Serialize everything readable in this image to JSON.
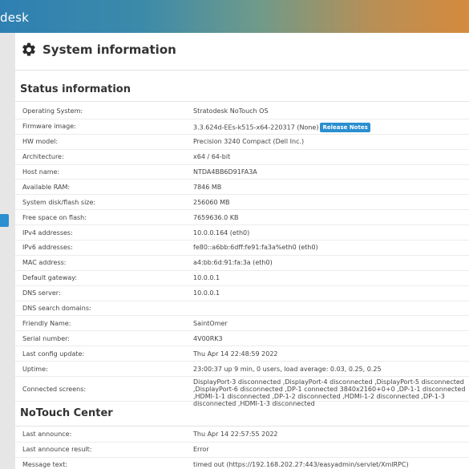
{
  "header": {
    "brand": "desk"
  },
  "page": {
    "title": "System information"
  },
  "status": {
    "title": "Status information",
    "rows": [
      {
        "label": "Operating System:",
        "value": "Stratodesk NoTouch OS"
      },
      {
        "label": "Firmware image:",
        "value": "3.3.624d-EEs-k515-x64-220317 (None)",
        "badge": "Release Notes"
      },
      {
        "label": "HW model:",
        "value": "Precision 3240 Compact (Dell Inc.)"
      },
      {
        "label": "Architecture:",
        "value": "x64 / 64-bit"
      },
      {
        "label": "Host name:",
        "value": "NTDA4BB6D91FA3A"
      },
      {
        "label": "Available RAM:",
        "value": "7846 MB"
      },
      {
        "label": "System disk/flash size:",
        "value": "256060 MB"
      },
      {
        "label": "Free space on flash:",
        "value": "7659636.0 KB"
      },
      {
        "label": "IPv4 addresses:",
        "value": "10.0.0.164 (eth0)"
      },
      {
        "label": "IPv6 addresses:",
        "value": "fe80::a6bb:6dff:fe91:fa3a%eth0 (eth0)"
      },
      {
        "label": "MAC address:",
        "value": "a4:bb:6d:91:fa:3a (eth0)"
      },
      {
        "label": "Default gateway:",
        "value": "10.0.0.1"
      },
      {
        "label": "DNS server:",
        "value": "10.0.0.1"
      },
      {
        "label": "DNS search domains:",
        "value": ""
      },
      {
        "label": "Friendly Name:",
        "value": "SaintOmer"
      },
      {
        "label": "Serial number:",
        "value": "4V00RK3"
      },
      {
        "label": "Last config update:",
        "value": "Thu Apr 14 22:48:59 2022"
      },
      {
        "label": "Uptime:",
        "value": "23:00:37 up 9 min, 0 users, load average: 0.03, 0.25, 0.25"
      },
      {
        "label": "Connected screens:",
        "value": "DisplayPort-3 disconnected ,DisplayPort-4 disconnected ,DisplayPort-5 disconnected ,DisplayPort-6 disconnected ,DP-1 connected 3840x2160+0+0 ,DP-1-1 disconnected ,HDMI-1-1 disconnected ,DP-1-2 disconnected ,HDMI-1-2 disconnected ,DP-1-3 disconnected ,HDMI-1-3 disconnected"
      }
    ]
  },
  "notouch": {
    "title": "NoTouch Center",
    "rows": [
      {
        "label": "Last announce:",
        "value": "Thu Apr 14 22:57:55 2022"
      },
      {
        "label": "Last announce result:",
        "value": "Error"
      },
      {
        "label": "Message text:",
        "value": "timed out (https://192.168.202.27:443/easyadmin/servlet/XmlRPC)"
      }
    ]
  },
  "icons": {
    "page_icon": "gear-icon"
  },
  "colors": {
    "accent": "#2b8fd0",
    "header_start": "#2f80b2",
    "header_end": "#d58a3d"
  }
}
